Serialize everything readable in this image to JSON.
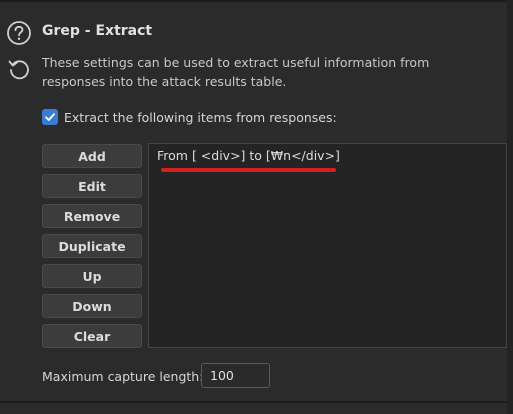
{
  "section": {
    "title": "Grep - Extract",
    "description": "These settings can be used to extract useful information from responses into the attack results table."
  },
  "icons": {
    "help": "help-icon",
    "reset": "reset-icon",
    "check": "checkmark-icon"
  },
  "checkbox": {
    "label": "Extract the following items from responses:",
    "checked": true
  },
  "buttons": {
    "add": "Add",
    "edit": "Edit",
    "remove": "Remove",
    "duplicate": "Duplicate",
    "up": "Up",
    "down": "Down",
    "clear": "Clear"
  },
  "list": {
    "items": [
      "From [ <div>] to [₩n</div>]"
    ]
  },
  "max_capture": {
    "label": "Maximum capture length:",
    "value": "100"
  },
  "colors": {
    "background": "#2b2b2b",
    "accent": "#3a7bd5",
    "annotation": "#d32020"
  }
}
